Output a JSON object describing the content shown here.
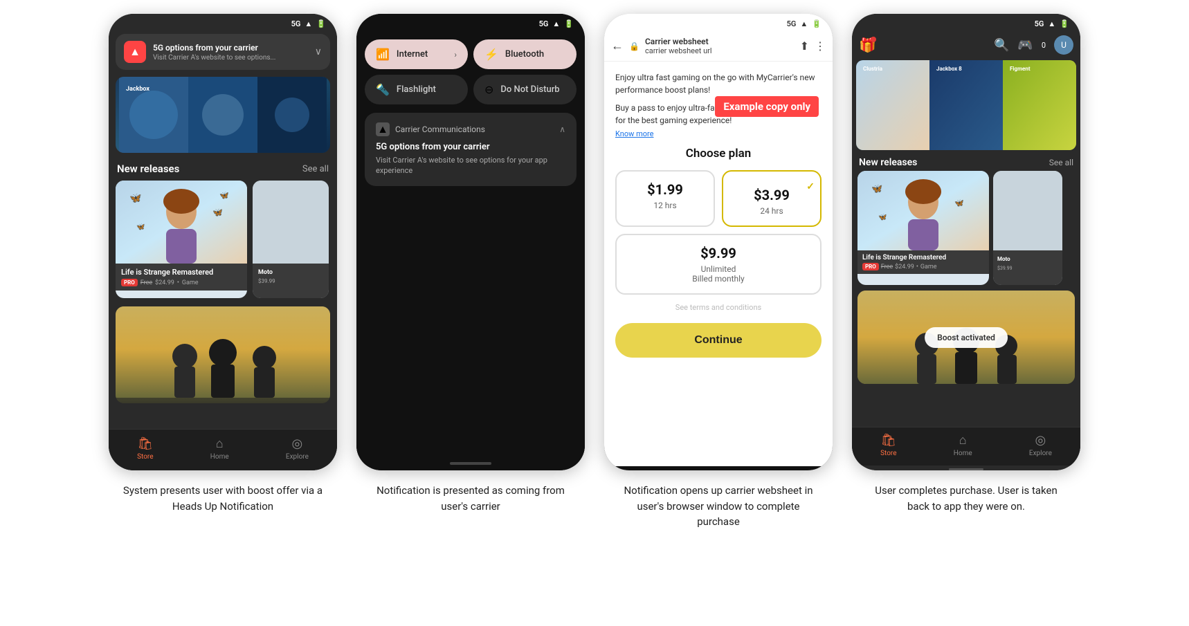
{
  "screens": [
    {
      "id": "screen1",
      "statusBar": "5G",
      "notification": {
        "title": "5G options from your carrier",
        "subtitle": "Visit Carrier A's website to see options..."
      },
      "sections": {
        "newReleases": "New releases",
        "seeAll": "See all"
      },
      "games": [
        {
          "title": "Life is Strange Remastered",
          "badge": "PRO",
          "freeLabel": "Free",
          "originalPrice": "$24.99",
          "genre": "Game"
        }
      ],
      "nav": [
        {
          "label": "Store",
          "active": true
        },
        {
          "label": "Home",
          "active": false
        },
        {
          "label": "Explore",
          "active": false
        }
      ]
    },
    {
      "id": "screen2",
      "statusBar": "5G",
      "quickSettings": [
        {
          "label": "Internet",
          "active": true,
          "hasArrow": true
        },
        {
          "label": "Bluetooth",
          "active": true,
          "hasArrow": false
        },
        {
          "label": "Flashlight",
          "active": false,
          "hasArrow": false
        },
        {
          "label": "Do Not Disturb",
          "active": false,
          "hasArrow": false
        }
      ],
      "notification": {
        "app": "Carrier Communications",
        "title": "5G options from your carrier",
        "body": "Visit Carrier A's website to see options for your app experience"
      }
    },
    {
      "id": "screen3",
      "statusBar": "5G",
      "browserUrl": "carrier websheet url",
      "carrierName": "Carrier websheet",
      "intro": "Enjoy ultra fast gaming on the go with MyCarrier's new performance boost plans!",
      "introBody": "Buy a pass to enjoy ultra-fast gaming at exclusive rates for the best gaming experience!",
      "knowMore": "Know more",
      "exampleCopy": "Example copy only",
      "choosePlan": "Choose plan",
      "plans": [
        {
          "price": "$1.99",
          "duration": "12 hrs",
          "selected": false
        },
        {
          "price": "$3.99",
          "duration": "24 hrs",
          "selected": true
        }
      ],
      "unlimitedPlan": {
        "price": "$9.99",
        "label": "Unlimited",
        "sub": "Billed monthly"
      },
      "terms": "See terms and conditions",
      "continueBtn": "Continue"
    },
    {
      "id": "screen4",
      "statusBar": "5G",
      "friendCount": "0",
      "sections": {
        "newReleases": "New releases",
        "seeAll": "See all"
      },
      "games": [
        {
          "title": "Life is Strange Remastered",
          "badge": "PRO",
          "freeLabel": "Free",
          "originalPrice": "$24.99",
          "genre": "Game"
        }
      ],
      "boastToast": "Boost activated",
      "nav": [
        {
          "label": "Store",
          "active": true
        },
        {
          "label": "Home",
          "active": false
        },
        {
          "label": "Explore",
          "active": false
        }
      ]
    }
  ],
  "captions": [
    "System presents user with boost offer via a Heads Up Notification",
    "Notification is presented as coming from user's carrier",
    "Notification opens up carrier websheet in user's browser window to complete purchase",
    "User completes purchase. User is taken back to app they were on."
  ]
}
